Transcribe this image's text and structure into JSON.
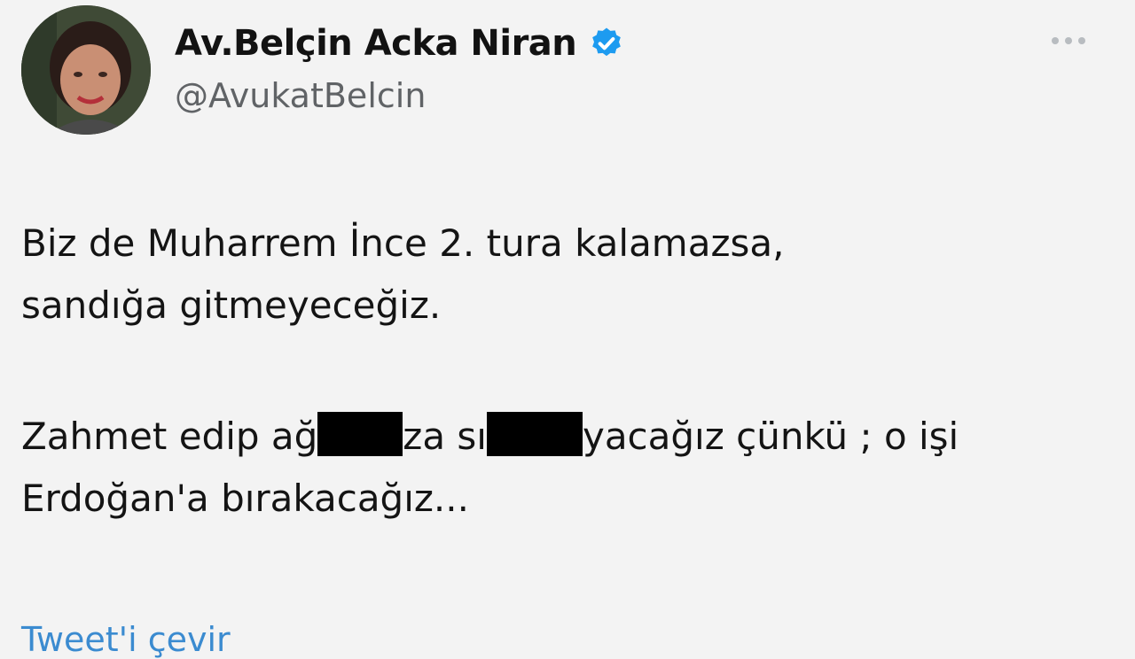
{
  "author": {
    "display_name": "Av.Belçin Acka Niran",
    "handle": "@AvukatBelcin",
    "verified_icon": "verified-badge-icon",
    "badge_color": "#1d9bf0"
  },
  "menu_icon": "more-options-icon",
  "tweet": {
    "line1": "Biz de Muharrem İnce 2. tura kalamazsa,",
    "line2": "sandığa gitmeyeceğiz.",
    "line3_part1": "Zahmet edip ağ",
    "line3_part2": "za sı",
    "line3_part3": "yacağız çünkü ; o işi",
    "line4": "Erdoğan'a bırakacağız..."
  },
  "translate_label": "Tweet'i çevir"
}
